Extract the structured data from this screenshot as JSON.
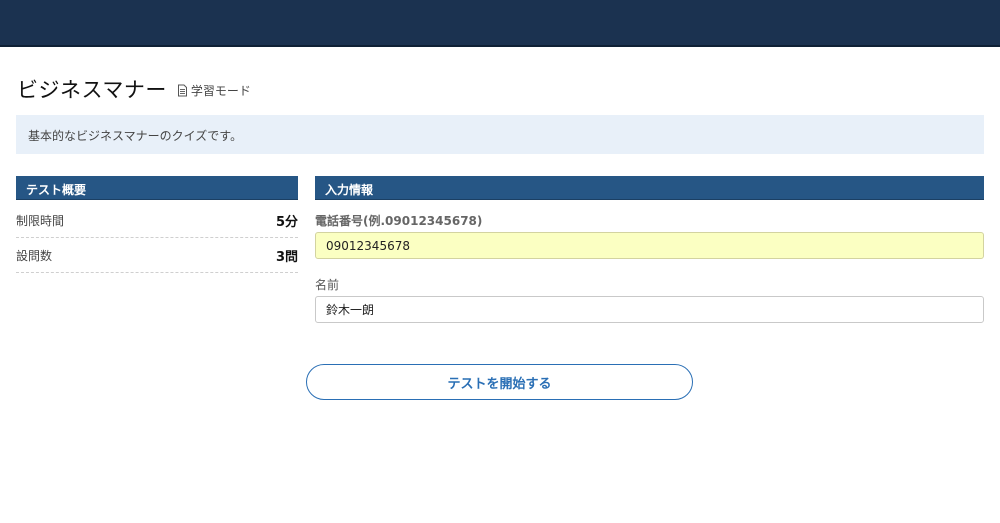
{
  "header": {},
  "page": {
    "title": "ビジネスマナー",
    "mode_label": "学習モード",
    "description": "基本的なビジネスマナーのクイズです。"
  },
  "summary": {
    "header": "テスト概要",
    "rows": [
      {
        "label": "制限時間",
        "value": "5分"
      },
      {
        "label": "設問数",
        "value": "3問"
      }
    ]
  },
  "form": {
    "header": "入力情報",
    "phone_label": "電話番号(例.09012345678)",
    "phone_value": "09012345678",
    "name_label": "名前",
    "name_value": "鈴木一朗"
  },
  "actions": {
    "start_label": "テストを開始する"
  },
  "colors": {
    "topbar": "#1b3250",
    "section_header": "#265685",
    "desc_bg": "#e8f0f9",
    "phone_bg": "#fbffc2",
    "button_accent": "#2a6fb5"
  },
  "icons": {
    "mode": "document-icon"
  }
}
